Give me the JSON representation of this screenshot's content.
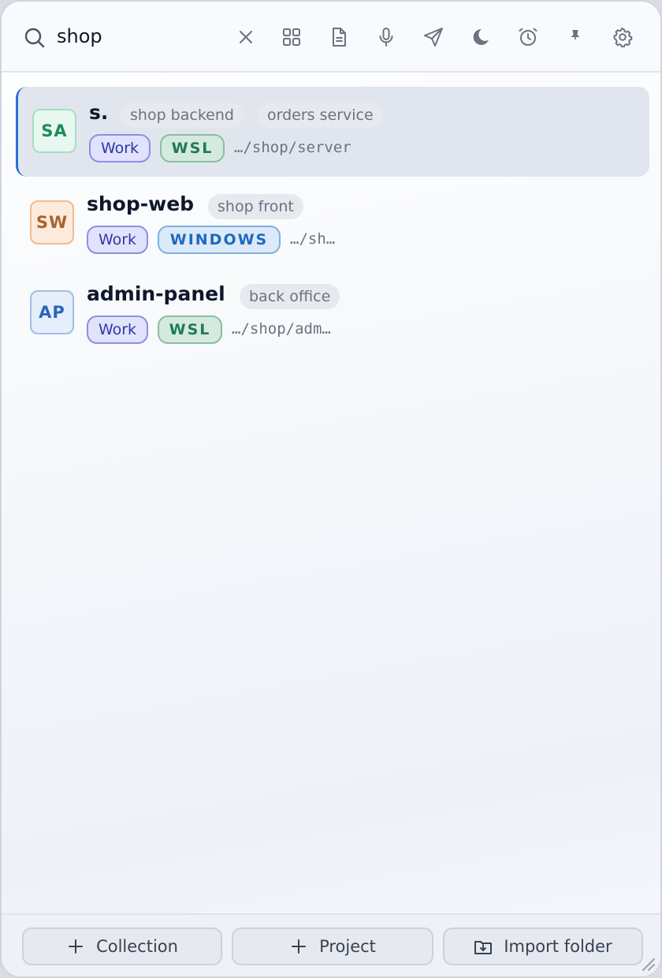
{
  "search": {
    "query": "shop"
  },
  "toolbar": {
    "clear": "close-icon",
    "collections": "grid-icon",
    "notes": "document-icon",
    "voice": "microphone-icon",
    "send": "send-icon",
    "theme": "moon-icon",
    "timer": "alarm-icon",
    "pin": "pin-icon",
    "settings": "gear-icon"
  },
  "projects": [
    {
      "initials": "SA",
      "name": "s.",
      "chips": [
        "shop backend",
        "orders service"
      ],
      "group": "Work",
      "env": "WSL",
      "path": "…/shop/server",
      "selected": true,
      "avatar_bg": "#e8f7ef",
      "avatar_border": "#a6dfc0",
      "avatar_color": "#1f8a5a"
    },
    {
      "initials": "SW",
      "name": "shop-web",
      "chips": [
        "shop front"
      ],
      "group": "Work",
      "env": "WINDOWS",
      "path": "…/sh…",
      "selected": false,
      "avatar_bg": "#fcebdd",
      "avatar_border": "#f0bb91",
      "avatar_color": "#a8632e"
    },
    {
      "initials": "AP",
      "name": "admin-panel",
      "chips": [
        "back office"
      ],
      "group": "Work",
      "env": "WSL",
      "path": "…/shop/adm…",
      "selected": false,
      "avatar_bg": "#e5eefb",
      "avatar_border": "#9fbfe8",
      "avatar_color": "#2a67b8"
    }
  ],
  "footer": {
    "collection_label": "Collection",
    "project_label": "Project",
    "import_label": "Import folder"
  }
}
